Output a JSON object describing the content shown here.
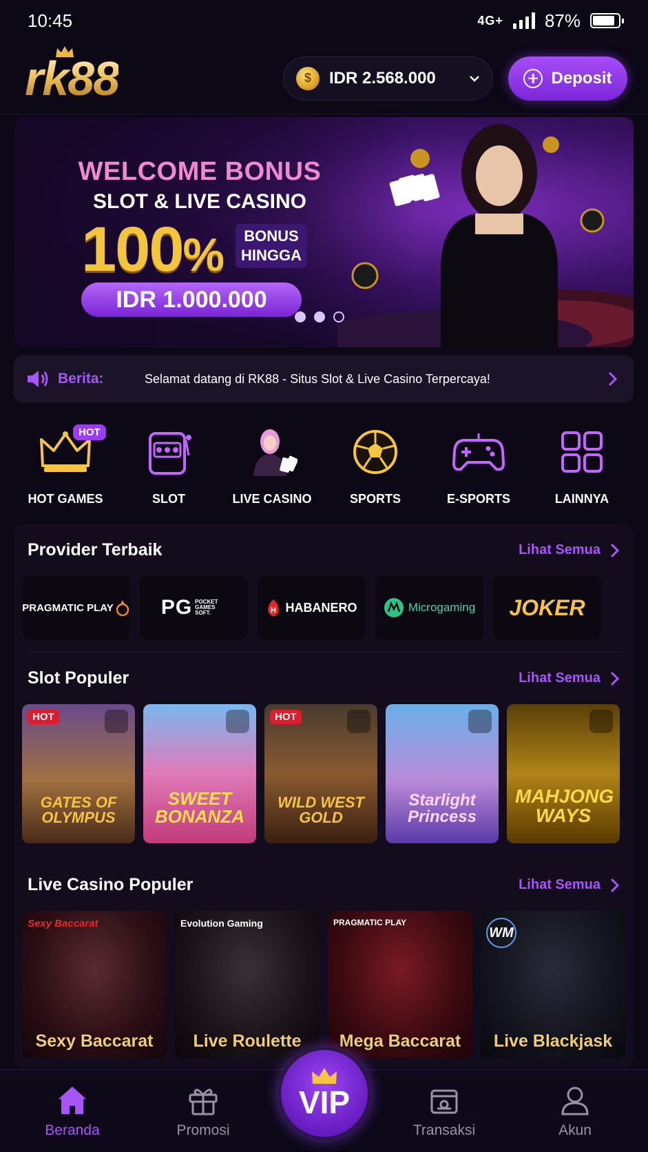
{
  "status": {
    "time": "10:45",
    "network": "4G+",
    "battery": "87%",
    "battery_level": 0.87
  },
  "header": {
    "logo": "rk88",
    "balance": "IDR 2.568.000",
    "deposit_label": "Deposit"
  },
  "banner": {
    "line1": "WELCOME BONUS",
    "line2": "SLOT & LIVE CASINO",
    "percent": "100",
    "percent_sign": "%",
    "bonus_line1": "BONUS",
    "bonus_line2": "HINGGA",
    "amount": "IDR 1.000.000"
  },
  "news": {
    "label": "Berita:",
    "text": "Selamat datang di RK88 - Situs Slot & Live Casino Terpercaya!"
  },
  "categories": [
    {
      "label": "HOT GAMES",
      "icon": "crown-icon",
      "badge": "HOT"
    },
    {
      "label": "SLOT",
      "icon": "slot-machine-icon"
    },
    {
      "label": "LIVE CASINO",
      "icon": "dealer-icon"
    },
    {
      "label": "SPORTS",
      "icon": "soccer-ball-icon"
    },
    {
      "label": "E-SPORTS",
      "icon": "gamepad-icon"
    },
    {
      "label": "LAINNYA",
      "icon": "grid-icon"
    }
  ],
  "providers_section": {
    "title": "Provider Terbaik",
    "see_all": "Lihat Semua"
  },
  "providers": [
    "PRAGMATIC PLAY",
    "PG",
    "HABANERO",
    "Microgaming",
    "JOKER"
  ],
  "provider_pg_sub": "POCKET GAMES SOFT.",
  "slots_section": {
    "title": "Slot Populer",
    "see_all": "Lihat Semua"
  },
  "slots": [
    {
      "title": "GATES OF OLYMPUS",
      "hot": "HOT"
    },
    {
      "title": "SWEET BONANZA"
    },
    {
      "title": "WILD WEST GOLD",
      "hot": "HOT"
    },
    {
      "title": "Starlight Princess"
    },
    {
      "title": "MAHJONG WAYS"
    }
  ],
  "live_section": {
    "title": "Live Casino Populer",
    "see_all": "Lihat Semua"
  },
  "lives": [
    {
      "title": "Sexy Baccarat",
      "provider": "Sexy Baccarat"
    },
    {
      "title": "Live Roulette",
      "provider": "Evolution Gaming"
    },
    {
      "title": "Mega Baccarat",
      "provider": "PRAGMATIC PLAY"
    },
    {
      "title": "Live Blackjask",
      "provider": "WM"
    }
  ],
  "nav": {
    "home": "Beranda",
    "promo": "Promosi",
    "vip": "VIP",
    "transaksi": "Transaksi",
    "akun": "Akun"
  },
  "colors": {
    "accent": "#a855f7",
    "gold": "#f2c53d",
    "background": "#0c0816"
  }
}
